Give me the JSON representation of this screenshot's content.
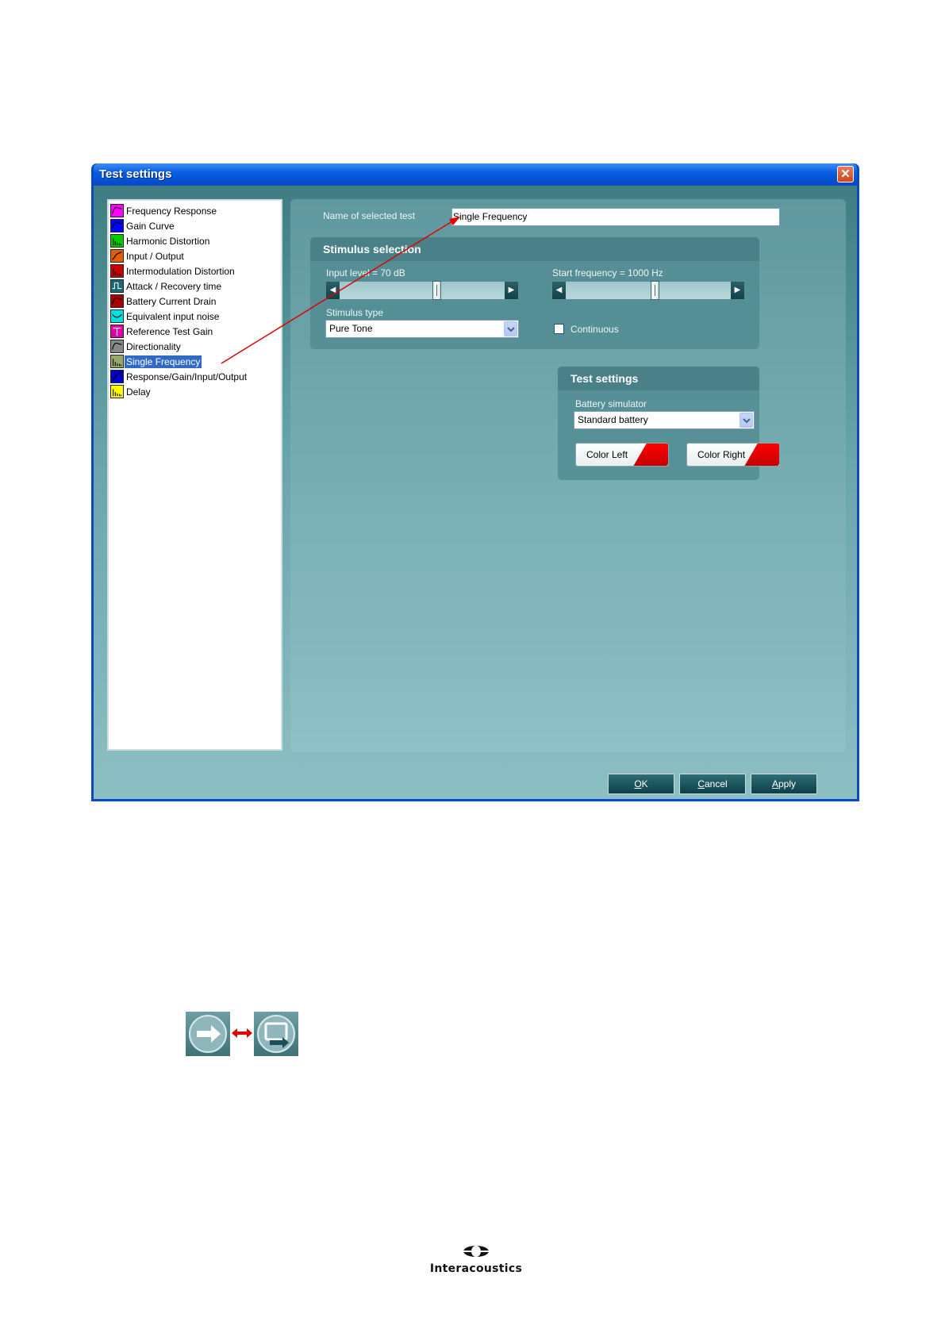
{
  "window": {
    "title": "Test settings",
    "close_label": "✕"
  },
  "tests": [
    {
      "label": "Frequency Response",
      "icon": "frequency-response-icon",
      "color": "#ff00ff",
      "glyph": "curve"
    },
    {
      "label": "Gain Curve",
      "icon": "gain-curve-icon",
      "color": "#0000ff",
      "glyph": "curve"
    },
    {
      "label": "Harmonic Distortion",
      "icon": "harmonic-distortion-icon",
      "color": "#00cc00",
      "glyph": "bars"
    },
    {
      "label": "Input / Output",
      "icon": "input-output-icon",
      "color": "#e06000",
      "glyph": "diag"
    },
    {
      "label": "Intermodulation Distortion",
      "icon": "intermodulation-distortion-icon",
      "color": "#cc0000",
      "glyph": "bars"
    },
    {
      "label": "Attack / Recovery time",
      "icon": "attack-recovery-icon",
      "color": "#1b6a78",
      "glyph": "step"
    },
    {
      "label": "Battery Current Drain",
      "icon": "battery-current-drain-icon",
      "color": "#aa0000",
      "glyph": "curve"
    },
    {
      "label": "Equivalent input noise",
      "icon": "equivalent-input-noise-icon",
      "color": "#00e0e0",
      "glyph": "dip"
    },
    {
      "label": "Reference Test Gain",
      "icon": "reference-test-gain-icon",
      "color": "#dd00aa",
      "glyph": "tee"
    },
    {
      "label": "Directionality",
      "icon": "directionality-icon",
      "color": "#888888",
      "glyph": "curve"
    },
    {
      "label": "Single Frequency",
      "icon": "single-frequency-icon",
      "color": "#9aa86a",
      "glyph": "bars",
      "selected": true
    },
    {
      "label": "Response/Gain/Input/Output",
      "icon": "response-gain-input-output-icon",
      "color": "#0000cc",
      "glyph": "diag"
    },
    {
      "label": "Delay",
      "icon": "delay-icon",
      "color": "#ffff00",
      "glyph": "bars"
    }
  ],
  "panel": {
    "name_label": "Name of selected test",
    "name_value": "Single Frequency",
    "stimulus": {
      "title": "Stimulus selection",
      "input_level_label": "Input level = 70 dB",
      "input_level_position": 0.55,
      "start_freq_label": "Start frequency = 1000 Hz",
      "start_freq_position": 0.55,
      "stimulus_type_label": "Stimulus type",
      "stimulus_type_value": "Pure Tone",
      "continuous_label": "Continuous",
      "continuous_checked": false
    },
    "test_settings": {
      "title": "Test settings",
      "battery_label": "Battery simulator",
      "battery_value": "Standard battery",
      "color_left_label": "Color Left",
      "color_right_label": "Color Right",
      "color_swatch": "#ff0000"
    }
  },
  "footer": {
    "ok_first": "O",
    "ok_rest": "K",
    "cancel_first": "C",
    "cancel_rest": "ancel",
    "apply_first": "A",
    "apply_rest": "pply"
  },
  "logo": {
    "text": "Interacoustics"
  }
}
